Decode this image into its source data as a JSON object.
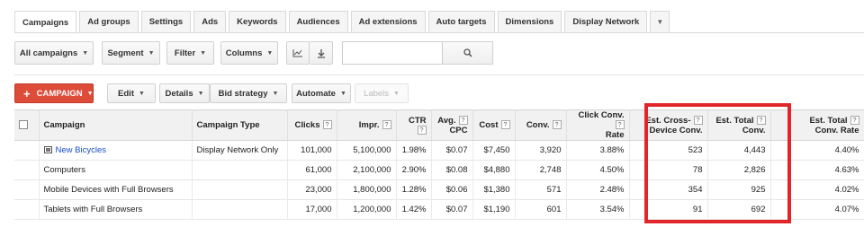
{
  "tabs": [
    "Campaigns",
    "Ad groups",
    "Settings",
    "Ads",
    "Keywords",
    "Audiences",
    "Ad extensions",
    "Auto targets",
    "Dimensions",
    "Display Network"
  ],
  "toolbar": {
    "all_campaigns": "All campaigns",
    "segment": "Segment",
    "filter": "Filter",
    "columns": "Columns"
  },
  "actions": {
    "campaign": "CAMPAIGN",
    "edit": "Edit",
    "details": "Details",
    "bid_strategy": "Bid strategy",
    "automate": "Automate",
    "labels": "Labels"
  },
  "table": {
    "headers": {
      "campaign": "Campaign",
      "campaign_type": "Campaign Type",
      "clicks": "Clicks",
      "impr": "Impr.",
      "ctr": "CTR",
      "avg_cpc_1": "Avg.",
      "avg_cpc_2": "CPC",
      "cost": "Cost",
      "conv": "Conv.",
      "click_conv_1": "Click Conv.",
      "click_conv_2": "Rate",
      "cross_1": "Est. Cross-",
      "cross_2": "Device Conv.",
      "total_1": "Est. Total",
      "total_2": "Conv.",
      "rate_1": "Est. Total",
      "rate_2": "Conv. Rate"
    },
    "rows": [
      {
        "campaign": "New Bicycles",
        "type": "Display Network Only",
        "clicks": "101,000",
        "impr": "5,100,000",
        "ctr": "1.98%",
        "cpc": "$0.07",
        "cost": "$7,450",
        "conv": "3,920",
        "ccr": "3.88%",
        "cross": "523",
        "total": "4,443",
        "rate": "4.40%"
      },
      {
        "campaign": "Computers",
        "type": "",
        "clicks": "61,000",
        "impr": "2,100,000",
        "ctr": "2.90%",
        "cpc": "$0.08",
        "cost": "$4,880",
        "conv": "2,748",
        "ccr": "4.50%",
        "cross": "78",
        "total": "2,826",
        "rate": "4.63%"
      },
      {
        "campaign": "Mobile Devices with Full Browsers",
        "type": "",
        "clicks": "23,000",
        "impr": "1,800,000",
        "ctr": "1.28%",
        "cpc": "$0.06",
        "cost": "$1,380",
        "conv": "571",
        "ccr": "2.48%",
        "cross": "354",
        "total": "925",
        "rate": "4.02%"
      },
      {
        "campaign": "Tablets with Full Browsers",
        "type": "",
        "clicks": "17,000",
        "impr": "1,200,000",
        "ctr": "1.42%",
        "cpc": "$0.07",
        "cost": "$1,190",
        "conv": "601",
        "ccr": "3.54%",
        "cross": "91",
        "total": "692",
        "rate": "4.07%"
      }
    ]
  },
  "colors": {
    "accent_red": "#dd4b39",
    "highlight": "#e0262a",
    "link": "#1a4fc4"
  }
}
